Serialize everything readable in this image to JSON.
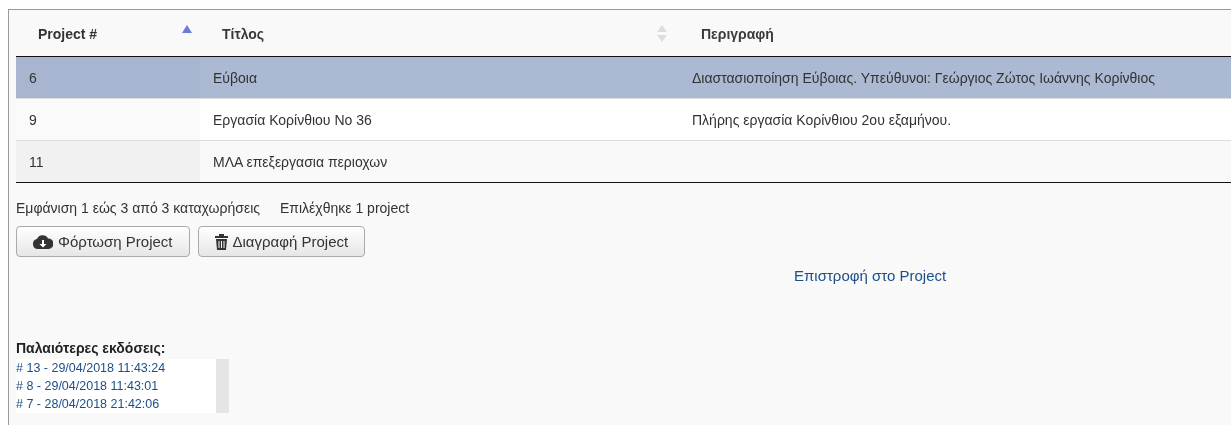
{
  "table": {
    "columns": [
      {
        "label": "Project #",
        "sortable": true,
        "sorted": true
      },
      {
        "label": "Τίτλος",
        "sortable": true,
        "sorted": false
      },
      {
        "label": "Περιγραφή"
      }
    ],
    "rows": [
      {
        "selected": true,
        "cells": [
          "6",
          "Εύβοια",
          "Διαστασιοποίηση Εύβοιας. Υπεύθυνοι: Γεώργιος Ζώτος Ιωάννης Κορίνθιος"
        ]
      },
      {
        "selected": false,
        "cells": [
          "9",
          "Εργασία Κορίνθιου Νο 36",
          "Πλήρης εργασία Κορίνθιου 2ου εξαμήνου."
        ]
      },
      {
        "selected": false,
        "cells": [
          "11",
          "ΜΛΑ επεξεργασια περιοχων",
          ""
        ]
      }
    ]
  },
  "info": {
    "entries": "Εμφάνιση 1 εώς 3 από 3 καταχωρήσεις",
    "selection": "Επιλέχθηκε 1 project"
  },
  "buttons": [
    {
      "kind": "load",
      "label": "Φόρτωση Project"
    },
    {
      "kind": "delete",
      "label": "Διαγραφή Project"
    }
  ],
  "back_link": "Επιστροφή στο Project",
  "versions": {
    "title": "Παλαιότερες εκδόσεις:",
    "items": [
      "# 13 - 29/04/2018 11:43:24",
      "# 8 - 29/04/2018 11:43:01",
      "# 7 - 28/04/2018 21:42:06"
    ]
  }
}
